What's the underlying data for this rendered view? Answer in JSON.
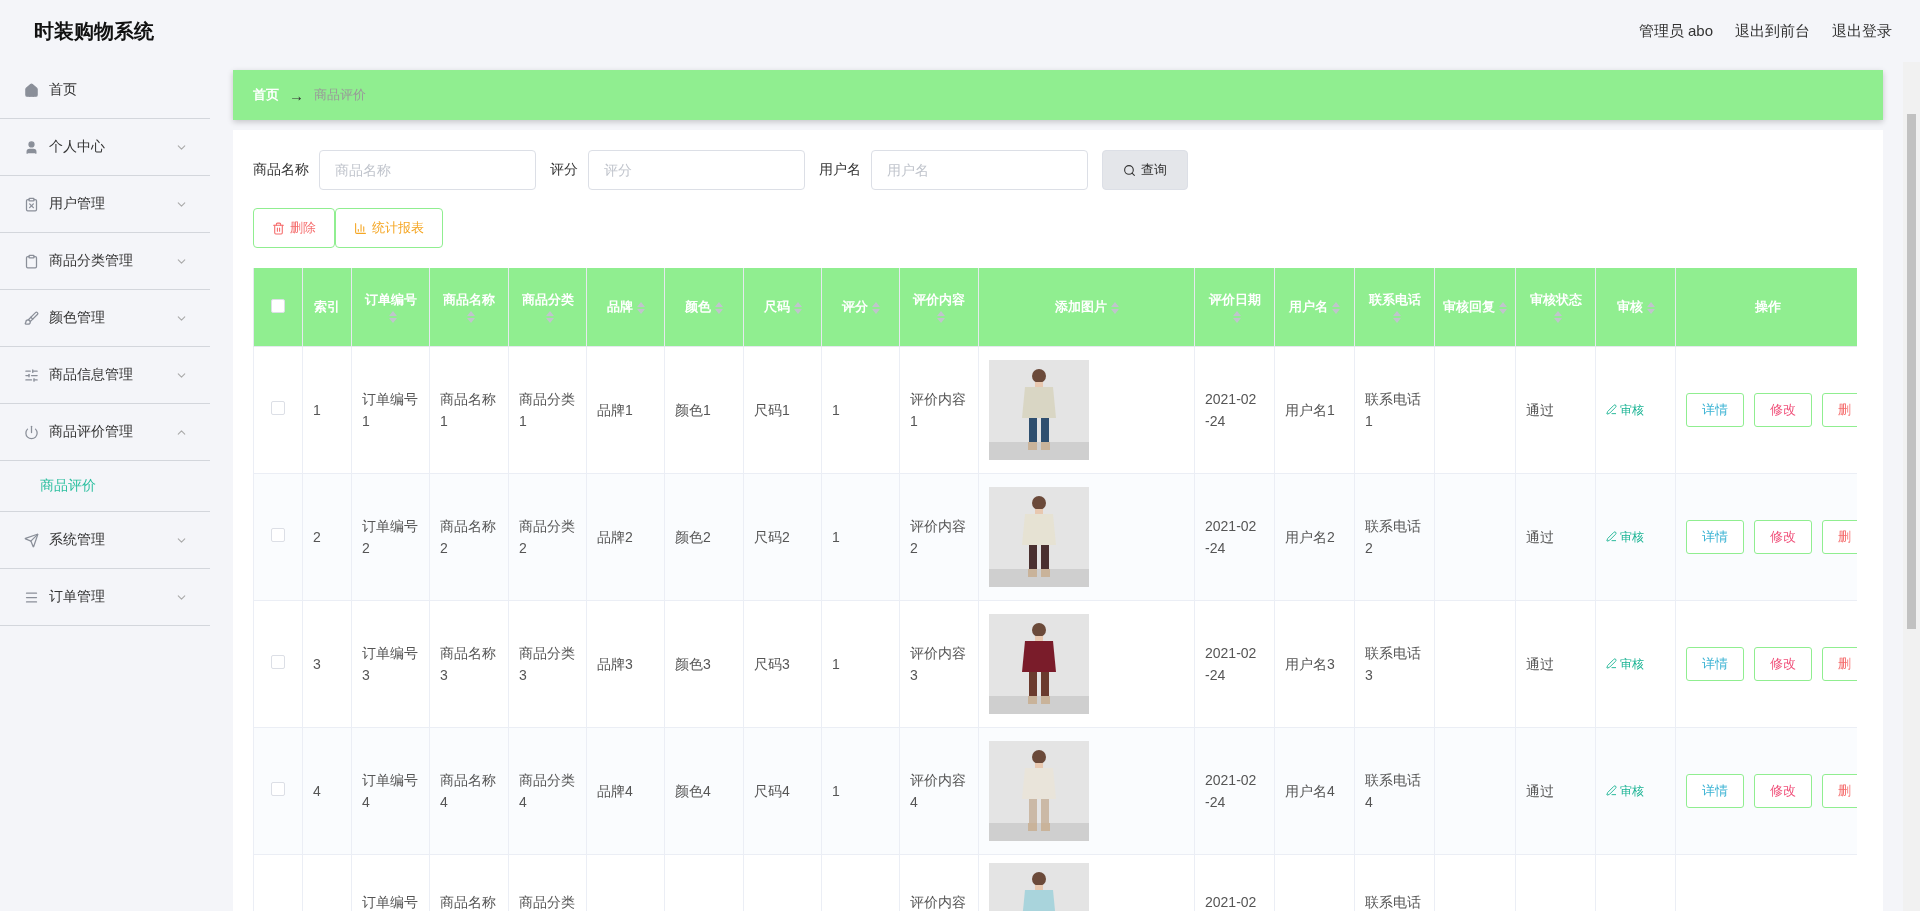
{
  "header": {
    "title": "时装购物系统",
    "links": [
      "管理员 abo",
      "退出到前台",
      "退出登录"
    ]
  },
  "sidebar": {
    "items": [
      {
        "label": "首页"
      },
      {
        "label": "个人中心",
        "expanded": false
      },
      {
        "label": "用户管理",
        "expanded": false
      },
      {
        "label": "商品分类管理",
        "expanded": false
      },
      {
        "label": "颜色管理",
        "expanded": false
      },
      {
        "label": "商品信息管理",
        "expanded": false
      },
      {
        "label": "商品评价管理",
        "expanded": true,
        "children": [
          {
            "label": "商品评价",
            "selected": true
          }
        ]
      },
      {
        "label": "系统管理",
        "expanded": false
      },
      {
        "label": "订单管理",
        "expanded": false
      }
    ]
  },
  "breadcrumb": {
    "home": "首页",
    "separator": "→",
    "current": "商品评价"
  },
  "search": {
    "fields": [
      {
        "label": "商品名称",
        "placeholder": "商品名称"
      },
      {
        "label": "评分",
        "placeholder": "评分"
      },
      {
        "label": "用户名",
        "placeholder": "用户名"
      }
    ],
    "button": "查询"
  },
  "actions": [
    {
      "kind": "delete",
      "label": "删除"
    },
    {
      "kind": "report",
      "label": "统计报表"
    }
  ],
  "table": {
    "all_checked": false,
    "columns": [
      {
        "label": "索引",
        "sortable": false
      },
      {
        "label": "订单编号",
        "sortable": true
      },
      {
        "label": "商品名称",
        "sortable": true
      },
      {
        "label": "商品分类",
        "sortable": true
      },
      {
        "label": "品牌",
        "sortable": true
      },
      {
        "label": "颜色",
        "sortable": true
      },
      {
        "label": "尺码",
        "sortable": true
      },
      {
        "label": "评分",
        "sortable": true
      },
      {
        "label": "评价内容",
        "sortable": true
      },
      {
        "label": "添加图片",
        "sortable": true
      },
      {
        "label": "评价日期",
        "sortable": true
      },
      {
        "label": "用户名",
        "sortable": true
      },
      {
        "label": "联系电话",
        "sortable": true
      },
      {
        "label": "审核回复",
        "sortable": true
      },
      {
        "label": "审核状态",
        "sortable": true
      },
      {
        "label": "审核",
        "sortable": true
      },
      {
        "label": "操作",
        "sortable": false
      }
    ],
    "rows": [
      {
        "checked": false,
        "cells": [
          "1",
          "订单编号1",
          "商品名称1",
          "商品分类1",
          "品牌1",
          "颜色1",
          "尺码1",
          "1",
          "评价内容1",
          "",
          "2021-02-24",
          "用户名1",
          "联系电话1",
          "",
          "通过"
        ],
        "audit": "审核",
        "ops": [
          "详情",
          "修改",
          "删"
        ]
      },
      {
        "checked": false,
        "cells": [
          "2",
          "订单编号2",
          "商品名称2",
          "商品分类2",
          "品牌2",
          "颜色2",
          "尺码2",
          "1",
          "评价内容2",
          "",
          "2021-02-24",
          "用户名2",
          "联系电话2",
          "",
          "通过"
        ],
        "audit": "审核",
        "ops": [
          "详情",
          "修改",
          "删"
        ]
      },
      {
        "checked": false,
        "cells": [
          "3",
          "订单编号3",
          "商品名称3",
          "商品分类3",
          "品牌3",
          "颜色3",
          "尺码3",
          "1",
          "评价内容3",
          "",
          "2021-02-24",
          "用户名3",
          "联系电话3",
          "",
          "通过"
        ],
        "audit": "审核",
        "ops": [
          "详情",
          "修改",
          "删"
        ]
      },
      {
        "checked": false,
        "cells": [
          "4",
          "订单编号4",
          "商品名称4",
          "商品分类4",
          "品牌4",
          "颜色4",
          "尺码4",
          "1",
          "评价内容4",
          "",
          "2021-02-24",
          "用户名4",
          "联系电话4",
          "",
          "通过"
        ],
        "audit": "审核",
        "ops": [
          "详情",
          "修改",
          "删"
        ]
      },
      {
        "cells": [
          "",
          "订单编号",
          "商品名称",
          "商品分类",
          "",
          "",
          "",
          "",
          "评价内容",
          "",
          "2021-02",
          "",
          "联系电话",
          "",
          ""
        ],
        "ops": []
      }
    ]
  }
}
